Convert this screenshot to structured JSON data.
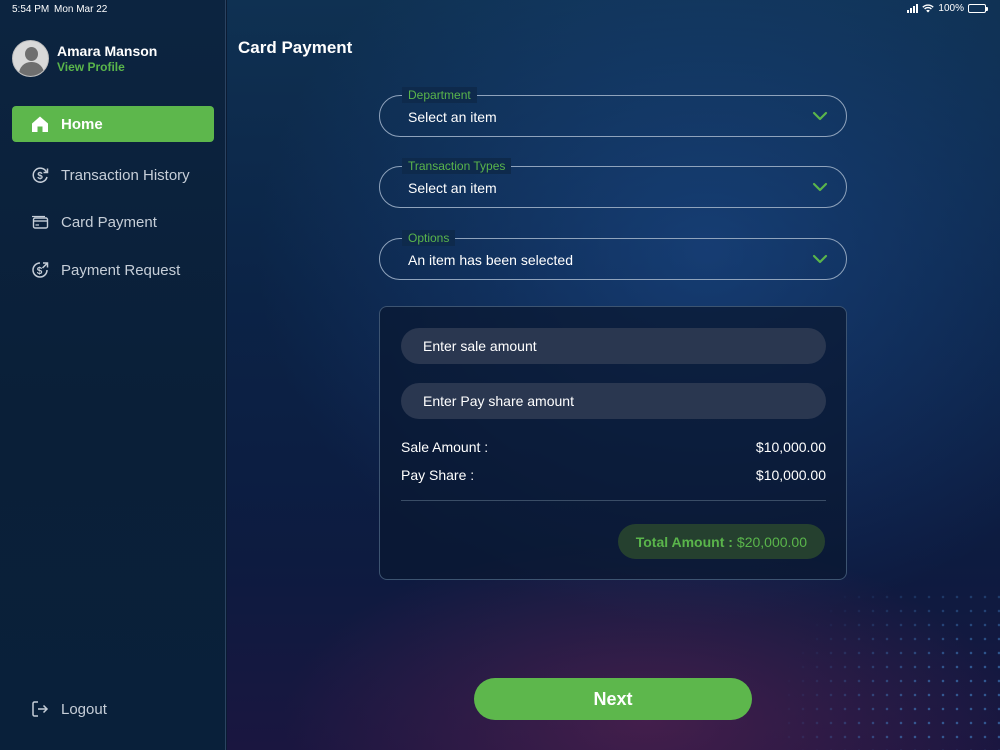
{
  "status_bar": {
    "time": "5:54 PM",
    "date": "Mon Mar 22",
    "battery": "100%",
    "icons": [
      "cellular-signal-icon",
      "wifi-icon",
      "battery-icon"
    ]
  },
  "profile": {
    "name": "Amara Manson",
    "link": "View Profile"
  },
  "nav": {
    "items": [
      {
        "label": "Home",
        "icon": "home-icon",
        "active": true
      },
      {
        "label": "Transaction History",
        "icon": "dollar-cycle-icon",
        "active": false
      },
      {
        "label": "Card Payment",
        "icon": "card-icon",
        "active": false
      },
      {
        "label": "Payment Request",
        "icon": "dollar-request-icon",
        "active": false
      }
    ],
    "logout": {
      "label": "Logout",
      "icon": "logout-icon"
    }
  },
  "page": {
    "title": "Card Payment"
  },
  "form": {
    "department": {
      "label": "Department",
      "value": "Select an item"
    },
    "transaction_types": {
      "label": "Transaction Types",
      "value": "Select an item"
    },
    "options": {
      "label": "Options",
      "value": "An item has been selected"
    },
    "sale_amount_placeholder": "Enter sale amount",
    "pay_share_placeholder": "Enter Pay share amount",
    "summary": {
      "sale_label": "Sale Amount :",
      "sale_value": "$10,000.00",
      "pay_share_label": "Pay Share :",
      "pay_share_value": "$10,000.00",
      "total_label": "Total Amount :",
      "total_value": "$20,000.00"
    }
  },
  "actions": {
    "next_label": "Next"
  },
  "colors": {
    "accent_green": "#5db74c",
    "sidebar_bg": "#0c2440",
    "field_bg": "#2a3750"
  }
}
